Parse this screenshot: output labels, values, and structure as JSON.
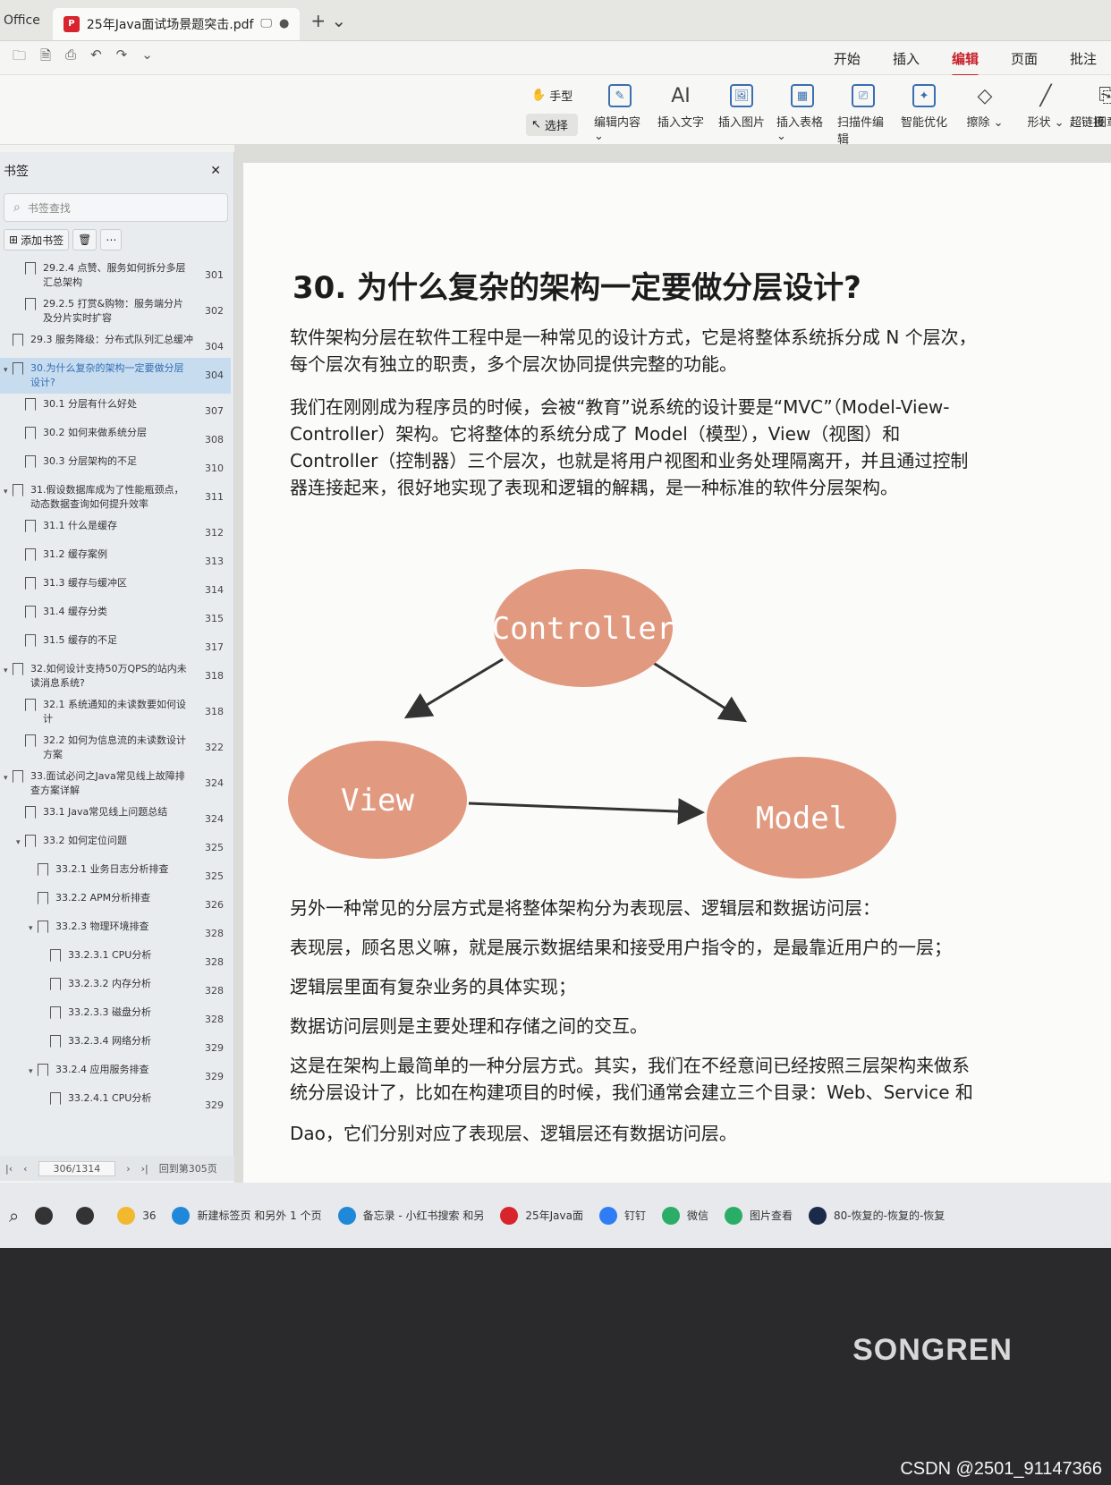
{
  "titlebar": {
    "app": "Office",
    "tab_title": "25年Java面试场景题突击.pdf",
    "pdf_badge": "P",
    "dot": "●",
    "new_tab": "+ ⌄"
  },
  "menubar": {
    "quick": [
      "🗀",
      "🗎",
      "⎙",
      "↶",
      "↷",
      "⌄"
    ],
    "items": [
      "开始",
      "插入",
      "编辑",
      "页面",
      "批注"
    ],
    "active": "编辑"
  },
  "ribbon": {
    "hand": "手型",
    "select": "选择",
    "tools": [
      {
        "icon": "✎",
        "label": "编辑内容 ⌄"
      },
      {
        "icon": "AI",
        "label": "插入文字"
      },
      {
        "icon": "🖼",
        "label": "插入图片"
      },
      {
        "icon": "▦",
        "label": "插入表格 ⌄"
      },
      {
        "icon": "⎚",
        "label": "扫描件编辑"
      },
      {
        "icon": "✦",
        "label": "智能优化"
      },
      {
        "icon": "◇",
        "label": "擦除 ⌄"
      },
      {
        "icon": "╱",
        "label": "形状 ⌄"
      },
      {
        "icon": "⎘",
        "label": "图章"
      }
    ],
    "link": "超链接"
  },
  "sidebar": {
    "title": "书签",
    "close": "✕",
    "search_placeholder": "书签查找",
    "add": "添加书签",
    "bookmarks": [
      {
        "arrow": "",
        "indent": 1,
        "text": "29.2.4 点赞、服务如何拆分多层汇总架构",
        "page": "301"
      },
      {
        "arrow": "",
        "indent": 1,
        "text": "29.2.5 打赏&购物：服务端分片及分片实时扩容",
        "page": "302"
      },
      {
        "arrow": "",
        "indent": 0,
        "text": "29.3 服务降级：分布式队列汇总缓冲",
        "page": "304"
      },
      {
        "arrow": "▾",
        "indent": 0,
        "text": "30.为什么复杂的架构一定要做分层设计?",
        "page": "304",
        "active": true
      },
      {
        "arrow": "",
        "indent": 1,
        "text": "30.1 分层有什么好处",
        "page": "307"
      },
      {
        "arrow": "",
        "indent": 1,
        "text": "30.2 如何来做系统分层",
        "page": "308"
      },
      {
        "arrow": "",
        "indent": 1,
        "text": "30.3 分层架构的不足",
        "page": "310"
      },
      {
        "arrow": "▾",
        "indent": 0,
        "text": "31.假设数据库成为了性能瓶颈点，动态数据查询如何提升效率",
        "page": "311"
      },
      {
        "arrow": "",
        "indent": 1,
        "text": "31.1 什么是缓存",
        "page": "312"
      },
      {
        "arrow": "",
        "indent": 1,
        "text": "31.2 缓存案例",
        "page": "313"
      },
      {
        "arrow": "",
        "indent": 1,
        "text": "31.3 缓存与缓冲区",
        "page": "314"
      },
      {
        "arrow": "",
        "indent": 1,
        "text": "31.4 缓存分类",
        "page": "315"
      },
      {
        "arrow": "",
        "indent": 1,
        "text": "31.5 缓存的不足",
        "page": "317"
      },
      {
        "arrow": "▾",
        "indent": 0,
        "text": "32.如何设计支持50万QPS的站内未读消息系统?",
        "page": "318"
      },
      {
        "arrow": "",
        "indent": 1,
        "text": "32.1 系统通知的未读数要如何设计",
        "page": "318"
      },
      {
        "arrow": "",
        "indent": 1,
        "text": "32.2 如何为信息流的未读数设计方案",
        "page": "322"
      },
      {
        "arrow": "▾",
        "indent": 0,
        "text": "33.面试必问之Java常见线上故障排查方案详解",
        "page": "324"
      },
      {
        "arrow": "",
        "indent": 1,
        "text": "33.1 Java常见线上问题总结",
        "page": "324"
      },
      {
        "arrow": "▾",
        "indent": 1,
        "text": "33.2 如何定位问题",
        "page": "325"
      },
      {
        "arrow": "",
        "indent": 2,
        "text": "33.2.1 业务日志分析排查",
        "page": "325"
      },
      {
        "arrow": "",
        "indent": 2,
        "text": "33.2.2 APM分析排查",
        "page": "326"
      },
      {
        "arrow": "▾",
        "indent": 2,
        "text": "33.2.3 物理环境排查",
        "page": "328"
      },
      {
        "arrow": "",
        "indent": 3,
        "text": "33.2.3.1 CPU分析",
        "page": "328"
      },
      {
        "arrow": "",
        "indent": 3,
        "text": "33.2.3.2 内存分析",
        "page": "328"
      },
      {
        "arrow": "",
        "indent": 3,
        "text": "33.2.3.3 磁盘分析",
        "page": "328"
      },
      {
        "arrow": "",
        "indent": 3,
        "text": "33.2.3.4 网络分析",
        "page": "329"
      },
      {
        "arrow": "▾",
        "indent": 2,
        "text": "33.2.4 应用服务排查",
        "page": "329"
      },
      {
        "arrow": "",
        "indent": 3,
        "text": "33.2.4.1 CPU分析",
        "page": "329"
      }
    ],
    "page_counter": "306/1314",
    "back_to": "回到第305页"
  },
  "document": {
    "heading": "30.  为什么复杂的架构一定要做分层设计?",
    "p1": "软件架构分层在软件工程中是一种常见的设计方式，它是将整体系统拆分成 N 个层次，每个层次有独立的职责，多个层次协同提供完整的功能。",
    "p2": "我们在刚刚成为程序员的时候，会被“教育”说系统的设计要是“MVC”（Model-View-Controller）架构。它将整体的系统分成了 Model（模型），View（视图）和 Controller（控制器）三个层次，也就是将用户视图和业务处理隔离开，并且通过控制器连接起来，很好地实现了表现和逻辑的解耦，是一种标准的软件分层架构。",
    "diagram": {
      "controller": "Controller",
      "view": "View",
      "model": "Model",
      "fill": "#e19a80"
    },
    "p3": "另外一种常见的分层方式是将整体架构分为表现层、逻辑层和数据访问层：",
    "p4": "表现层，顾名思义嘛，就是展示数据结果和接受用户指令的，是最靠近用户的一层；",
    "p5": "逻辑层里面有复杂业务的具体实现；",
    "p6": "数据访问层则是主要处理和存储之间的交互。",
    "p7": "这是在架构上最简单的一种分层方式。其实，我们在不经意间已经按照三层架构来做系统分层设计了，比如在构建项目的时候，我们通常会建立三个目录：Web、Service 和",
    "p8": "Dao，它们分别对应了表现层、逻辑层还有数据访问层。"
  },
  "taskbar": {
    "items": [
      {
        "label": "",
        "color": "#333333"
      },
      {
        "label": "",
        "color": "#333333"
      },
      {
        "label": "36",
        "color": "#f2b830"
      },
      {
        "label": "新建标签页 和另外 1 个页",
        "color": "#1f88d9"
      },
      {
        "label": "备忘录 - 小红书搜索 和另",
        "color": "#1f88d9"
      },
      {
        "label": "25年Java面",
        "color": "#d8242c"
      },
      {
        "label": "钉钉",
        "color": "#2f7df6"
      },
      {
        "label": "微信",
        "color": "#2aae67"
      },
      {
        "label": "图片查看",
        "color": "#2aae67"
      },
      {
        "label": "80-恢复的-恢复的-恢复",
        "color": "#1b2a4a"
      }
    ]
  },
  "monitor": {
    "brand": "SONGREN"
  },
  "watermark": "CSDN @2501_91147366"
}
